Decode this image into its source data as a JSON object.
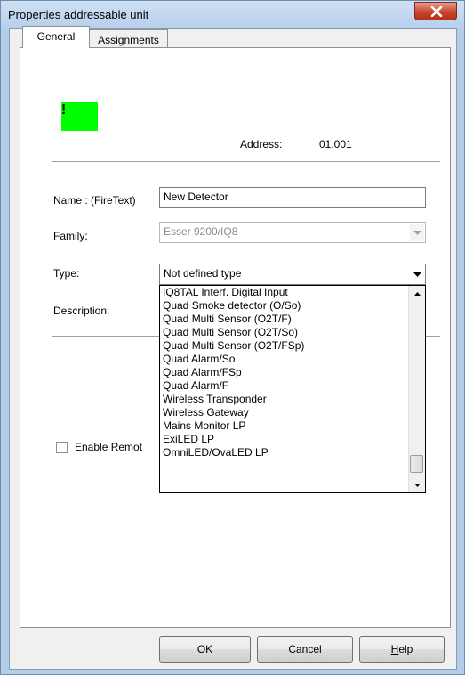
{
  "window": {
    "title": "Properties addressable unit"
  },
  "tabs": [
    {
      "label": "General",
      "active": true
    },
    {
      "label": "Assignments",
      "active": false
    }
  ],
  "status": {
    "icon_color": "#00ff00",
    "glyph": "!"
  },
  "address": {
    "label": "Address:",
    "value": "01.001"
  },
  "fields": {
    "name_label": "Name : (FireText)",
    "name_value": "New Detector",
    "family_label": "Family:",
    "family_value": "Esser 9200/IQ8",
    "type_label": "Type:",
    "type_value": "Not defined type",
    "description_label": "Description:"
  },
  "type_dropdown": {
    "items": [
      "IQ8TAL Interf. Digital Input",
      "Quad Smoke detector (O/So)",
      "Quad Multi Sensor (O2T/F)",
      "Quad Multi Sensor (O2T/So)",
      "Quad Multi Sensor (O2T/FSp)",
      "Quad Alarm/So",
      "Quad Alarm/FSp",
      "Quad Alarm/F",
      "Wireless Transponder",
      "Wireless Gateway",
      "Mains Monitor LP",
      "ExiLED LP",
      "OmniLED/OvaLED LP"
    ]
  },
  "enable_remote": {
    "label": "Enable Remot",
    "checked": false
  },
  "buttons": {
    "ok": "OK",
    "cancel": "Cancel",
    "help": "Help"
  }
}
